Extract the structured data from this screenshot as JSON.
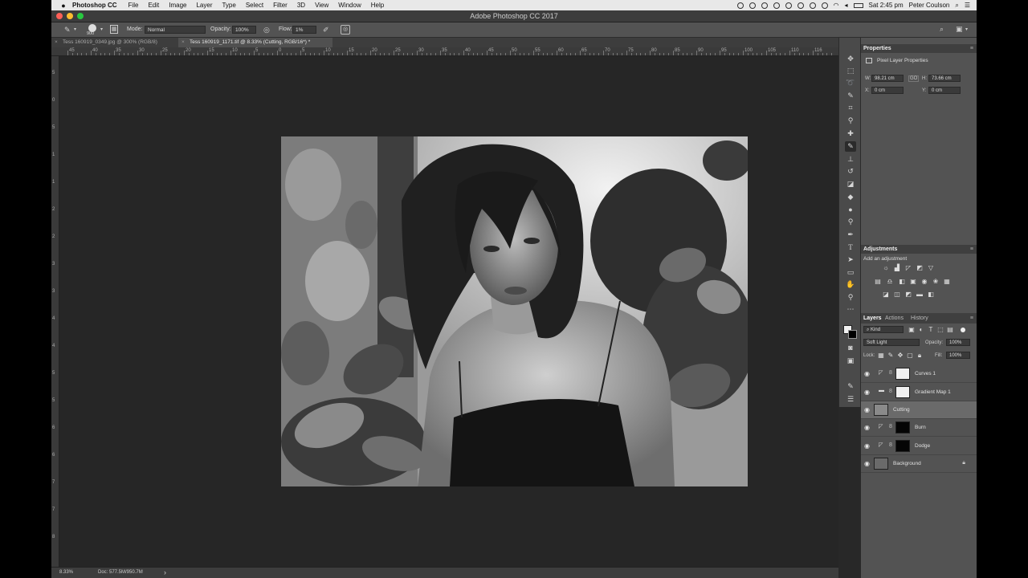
{
  "menubar": {
    "apple": "",
    "app_name": "Photoshop CC",
    "items": [
      "File",
      "Edit",
      "Image",
      "Layer",
      "Type",
      "Select",
      "Filter",
      "3D",
      "View",
      "Window",
      "Help"
    ],
    "clock": "Sat 2:45 pm",
    "user": "Peter Coulson"
  },
  "window": {
    "title": "Adobe Photoshop CC 2017"
  },
  "options": {
    "brush_size": "900",
    "mode_label": "Mode:",
    "mode_value": "Normal",
    "opacity_label": "Opacity:",
    "opacity_value": "100%",
    "flow_label": "Flow:",
    "flow_value": "1%"
  },
  "tabs": [
    {
      "label": "Tess 160919_0349.jpg @ 300% (RGB/8)",
      "active": false
    },
    {
      "label": "Tess 160919_1171.tif @ 8.33% (Cutting, RGB/16*) *",
      "active": true
    }
  ],
  "ruler_top": [
    "45",
    "40",
    "35",
    "30",
    "25",
    "20",
    "15",
    "10",
    "5",
    "0",
    "5",
    "10",
    "15",
    "20",
    "25",
    "30",
    "35",
    "40",
    "45",
    "50",
    "55",
    "60",
    "65",
    "70",
    "75",
    "80",
    "85",
    "90",
    "95",
    "100",
    "105",
    "110",
    "116"
  ],
  "ruler_left": [
    "5",
    "0",
    "5",
    "1",
    "1",
    "2",
    "2",
    "3",
    "3",
    "4",
    "4",
    "5",
    "5",
    "6",
    "6",
    "7",
    "7",
    "8"
  ],
  "status": {
    "zoom": "8.33%",
    "doc": "Doc: 577.5M/950.7M",
    "arrow": "›"
  },
  "properties": {
    "title": "Properties",
    "subtitle": "Pixel Layer Properties",
    "w_label": "W:",
    "w_value": "98.21 cm",
    "link": "GO",
    "h_label": "H:",
    "h_value": "73.66 cm",
    "x_label": "X:",
    "x_value": "0 cm",
    "y_label": "Y:",
    "y_value": "0 cm"
  },
  "adjustments": {
    "title": "Adjustments",
    "subtitle": "Add an adjustment"
  },
  "layers_panel": {
    "tabs": [
      "Layers",
      "Actions",
      "History"
    ],
    "kind": "Kind",
    "blend_mode": "Soft Light",
    "opacity_label": "Opacity:",
    "opacity_value": "100%",
    "lock_label": "Lock:",
    "fill_label": "Fill:",
    "fill_value": "100%",
    "layers": [
      {
        "name": "Curves 1"
      },
      {
        "name": "Gradient Map 1"
      },
      {
        "name": "Cutting"
      },
      {
        "name": "Burn"
      },
      {
        "name": "Dodge"
      },
      {
        "name": "Background"
      }
    ]
  },
  "colors": {
    "accent_selected_layer": "#6a6a6a",
    "panel_bg": "#535353",
    "canvas_bg": "#262626"
  }
}
